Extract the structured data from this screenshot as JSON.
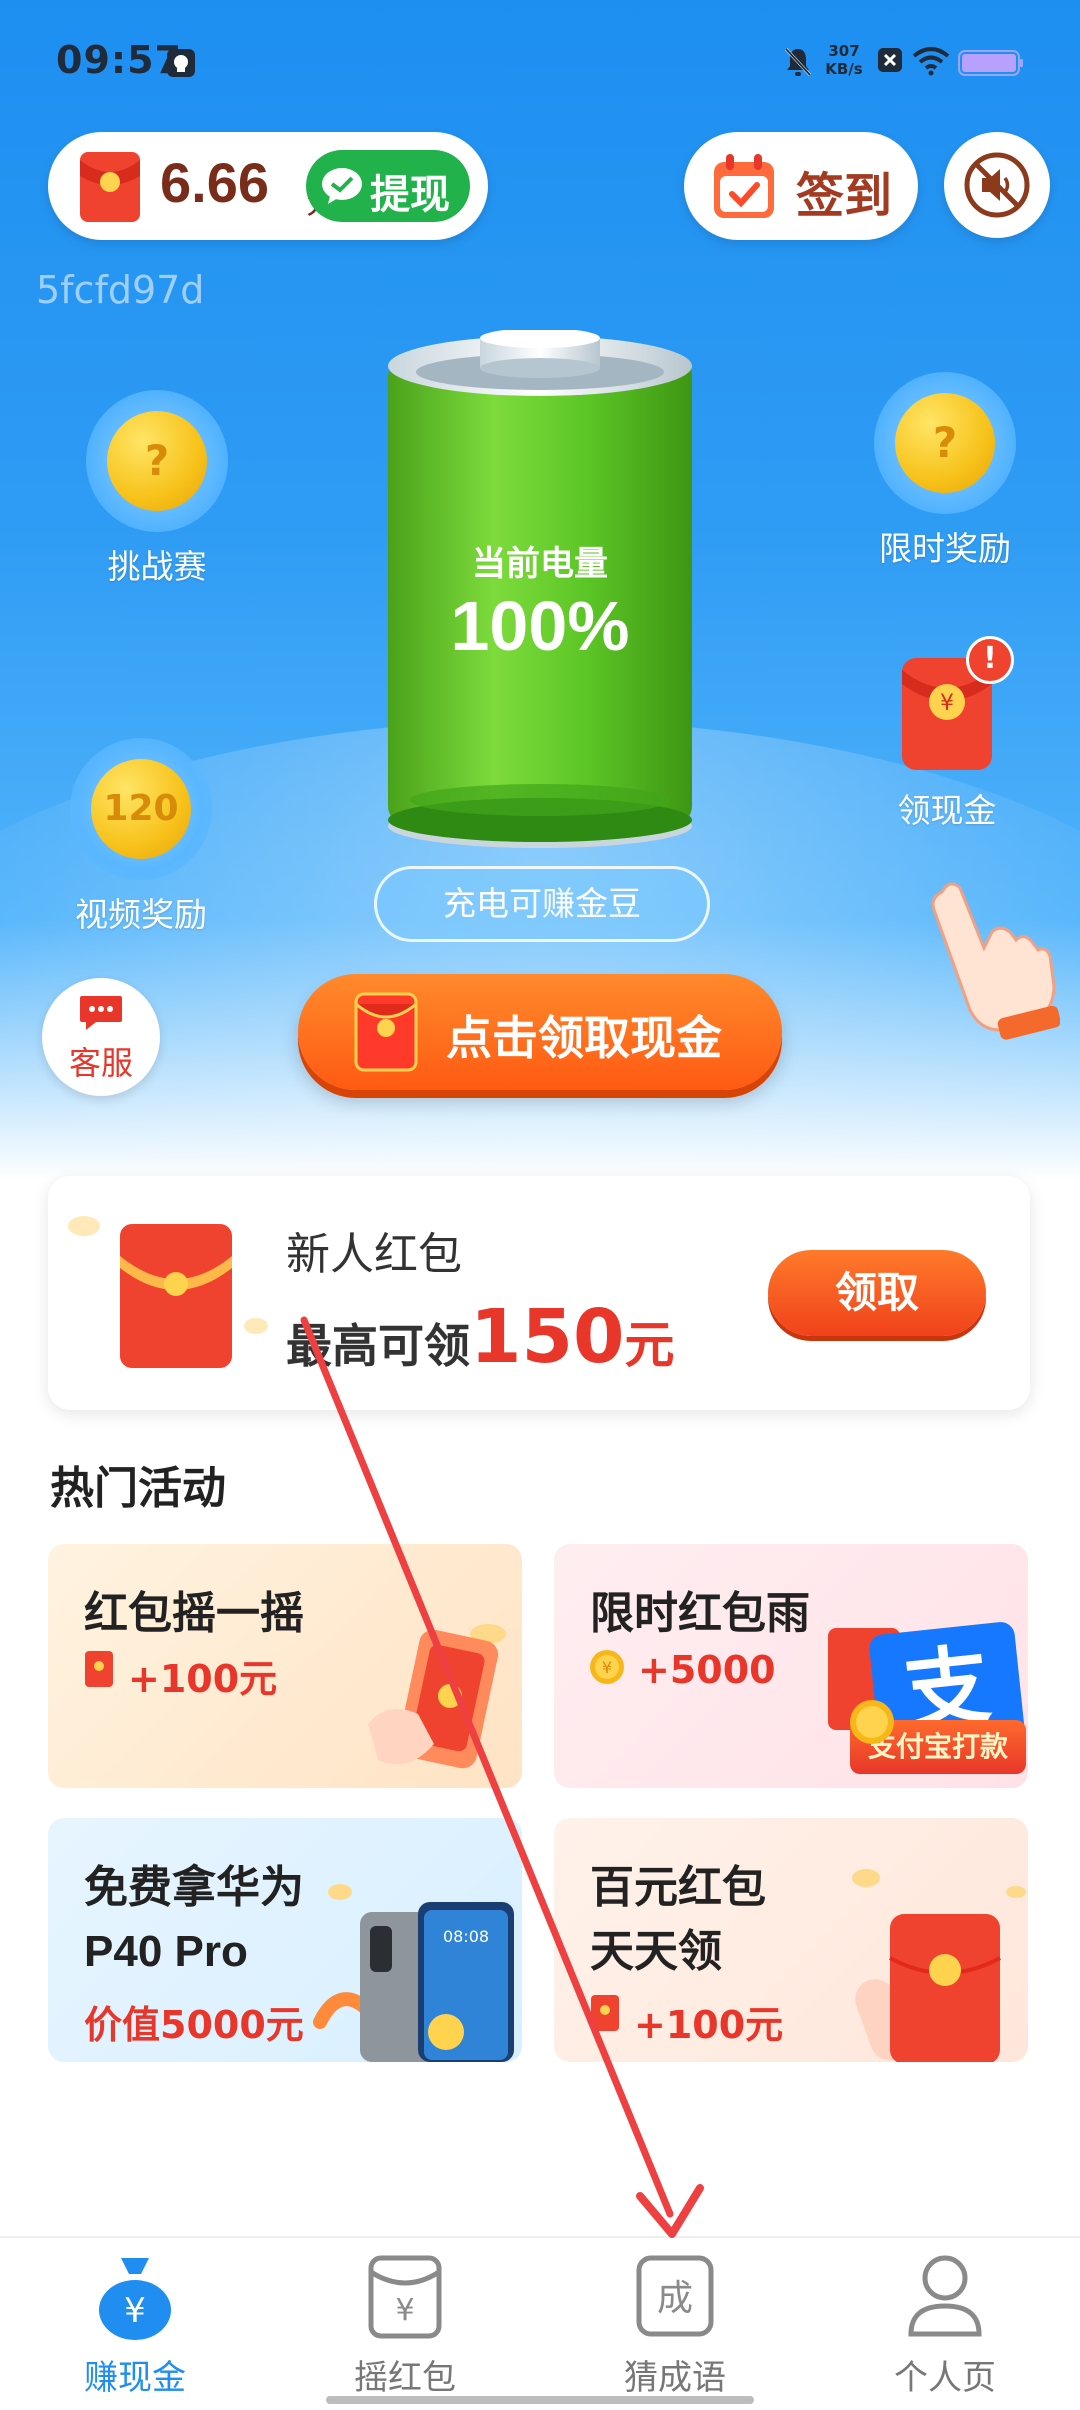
{
  "status_bar": {
    "time": "09:57",
    "net_speed_top": "307",
    "net_speed_bottom": "KB/s"
  },
  "header": {
    "balance_amount": "6.66",
    "balance_unit": "元",
    "withdraw_label": "提现",
    "signin_label": "签到"
  },
  "user_id": "5fcfd97d",
  "side_buttons": {
    "challenge": {
      "label": "挑战赛",
      "coin": "?"
    },
    "limited": {
      "label": "限时奖励",
      "coin": "?"
    },
    "video": {
      "label": "视频奖励",
      "coin": "120"
    },
    "cash": {
      "label": "领现金",
      "badge": "!"
    }
  },
  "battery": {
    "title": "当前电量",
    "percent": "100%",
    "charge_tag": "充电可赚金豆"
  },
  "customer_service_label": "客服",
  "cash_button_label": "点击领取现金",
  "new_user_card": {
    "title": "新人红包",
    "prefix": "最高可领",
    "amount": "150",
    "unit": "元",
    "claim_label": "领取"
  },
  "hot_section_title": "热门活动",
  "activities": [
    {
      "title": "红包摇一摇",
      "reward": "+100元"
    },
    {
      "title": "限时红包雨",
      "reward": "+5000",
      "badge": "支付宝打款",
      "logo": "支"
    },
    {
      "title_line1": "免费拿华为",
      "title_line2": "P40 Pro",
      "reward": "价值5000元",
      "phone_time": "08:08"
    },
    {
      "title_line1": "百元红包",
      "title_line2": "天天领",
      "reward": "+100元"
    }
  ],
  "bottom_nav": [
    {
      "label": "赚现金",
      "icon": "money-bag-icon",
      "glyph": "¥",
      "active": true
    },
    {
      "label": "摇红包",
      "icon": "red-envelope-icon",
      "glyph": "¥",
      "active": false
    },
    {
      "label": "猜成语",
      "icon": "idiom-icon",
      "glyph": "成",
      "active": false
    },
    {
      "label": "个人页",
      "icon": "person-icon",
      "active": false
    }
  ],
  "colors": {
    "brand_blue": "#1f8ef0",
    "accent_red": "#e8372a",
    "cta_orange": "#ff5a12",
    "withdraw_green": "#22b24c",
    "battery_green": "#54c62a"
  }
}
